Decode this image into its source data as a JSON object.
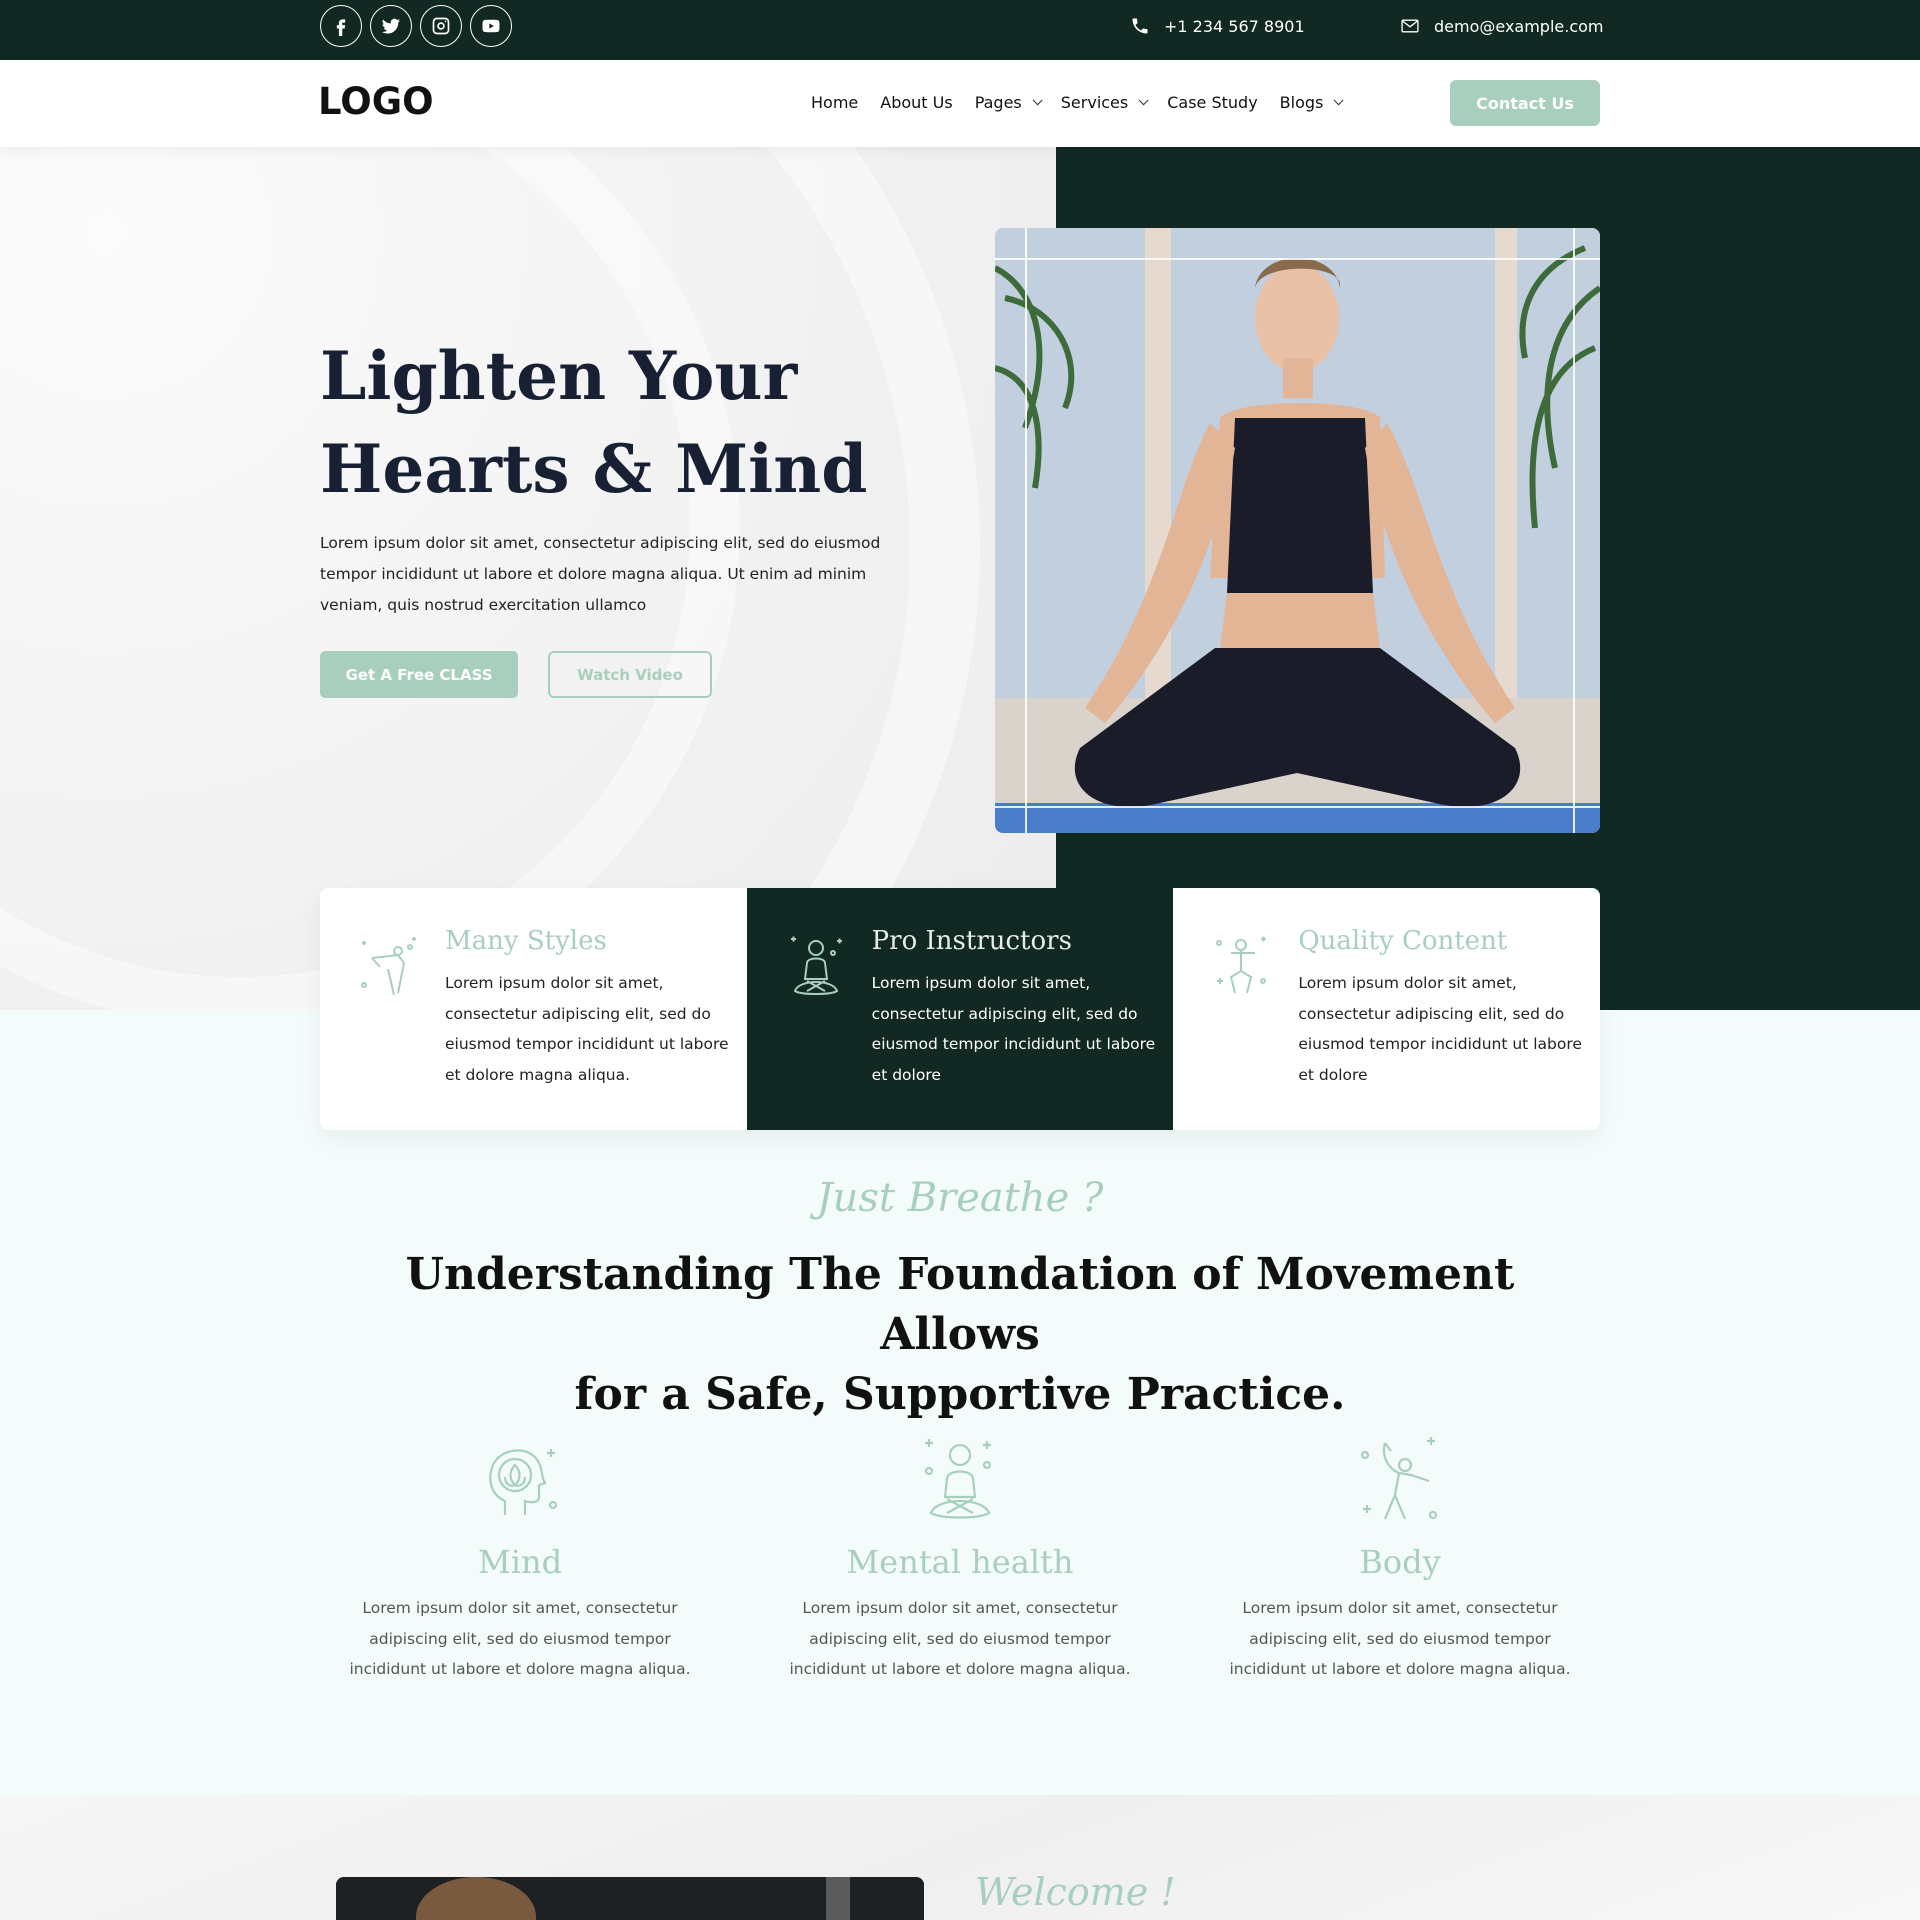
{
  "topbar": {
    "social": [
      "facebook-icon",
      "twitter-icon",
      "instagram-icon",
      "youtube-icon"
    ],
    "phone": "+1 234 567 8901",
    "email": "demo@example.com"
  },
  "header": {
    "logo": "LOGO",
    "nav": [
      {
        "label": "Home",
        "dropdown": false
      },
      {
        "label": "About Us",
        "dropdown": false
      },
      {
        "label": "Pages",
        "dropdown": true
      },
      {
        "label": "Services",
        "dropdown": true
      },
      {
        "label": "Case Study",
        "dropdown": false
      },
      {
        "label": "Blogs",
        "dropdown": true
      }
    ],
    "cta": "Contact Us"
  },
  "hero": {
    "title_line1": "Lighten Your",
    "title_line2": "Hearts & Mind",
    "text": "Lorem ipsum dolor sit amet, consectetur adipiscing elit, sed do eiusmod tempor incididunt ut labore et dolore magna aliqua. Ut enim ad minim veniam, quis nostrud exercitation ullamco",
    "primary_button": "Get A Free CLASS",
    "secondary_button": "Watch Video"
  },
  "cards": [
    {
      "title": "Many Styles",
      "text": "Lorem ipsum dolor sit amet, consectetur adipiscing elit, sed do eiusmod tempor incididunt ut labore et dolore magna aliqua.",
      "icon": "yoga-pose-icon"
    },
    {
      "title": "Pro Instructors",
      "text": "Lorem ipsum dolor sit amet, consectetur adipiscing elit, sed do eiusmod tempor incididunt ut labore et dolore",
      "icon": "meditation-icon"
    },
    {
      "title": "Quality Content",
      "text": "Lorem ipsum dolor sit amet, consectetur adipiscing elit, sed do eiusmod tempor incididunt ut labore et dolore",
      "icon": "squat-pose-icon"
    }
  ],
  "section": {
    "script": "Just Breathe ?",
    "title_line1": "Understanding The Foundation of Movement Allows",
    "title_line2": "for a Safe, Supportive Practice.",
    "pillars": [
      {
        "title": "Mind",
        "text": "Lorem ipsum dolor sit amet, consectetur adipiscing elit, sed do eiusmod tempor incididunt ut labore et dolore magna  aliqua.",
        "icon": "mind-lotus-icon"
      },
      {
        "title": "Mental health",
        "text": "Lorem ipsum dolor sit amet, consectetur adipiscing elit, sed do eiusmod tempor incididunt ut labore et dolore magna  aliqua.",
        "icon": "meditation-icon"
      },
      {
        "title": "Body",
        "text": "Lorem ipsum dolor sit amet, consectetur adipiscing elit, sed do eiusmod tempor incididunt ut labore et dolore magna  aliqua.",
        "icon": "dancer-pose-icon"
      }
    ]
  },
  "bottom": {
    "script": "Welcome !"
  },
  "colors": {
    "dark_green": "#122822",
    "mint": "#a8cfbd",
    "navy_text": "#182034",
    "section_bg": "#f3fcfb"
  }
}
